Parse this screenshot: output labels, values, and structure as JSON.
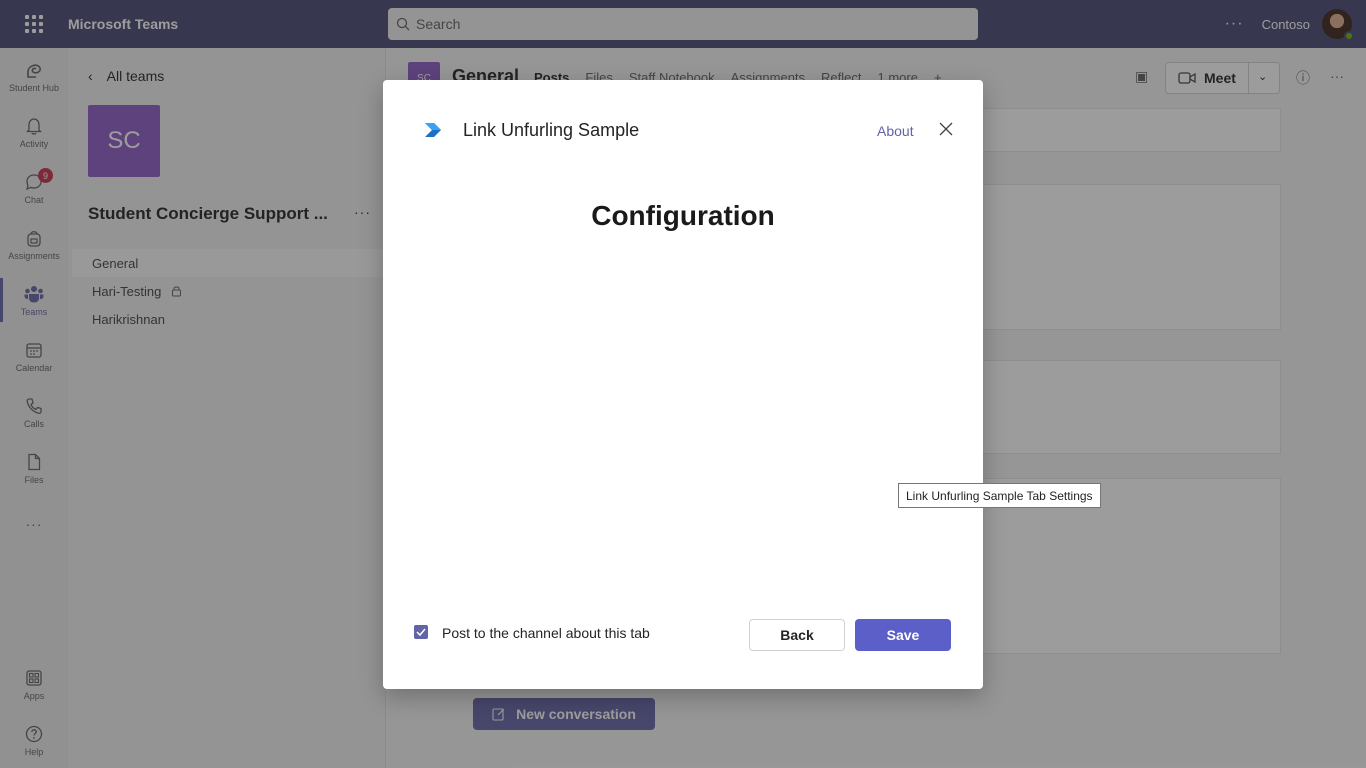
{
  "app": {
    "title": "Microsoft Teams",
    "org": "Contoso"
  },
  "search": {
    "placeholder": "Search"
  },
  "rail": {
    "items": [
      {
        "label": "Student Hub"
      },
      {
        "label": "Activity"
      },
      {
        "label": "Chat",
        "badge": "9"
      },
      {
        "label": "Assignments"
      },
      {
        "label": "Teams"
      },
      {
        "label": "Calendar"
      },
      {
        "label": "Calls"
      },
      {
        "label": "Files"
      },
      {
        "label": "Apps"
      },
      {
        "label": "Help"
      }
    ],
    "more": "···",
    "active": "Teams"
  },
  "team_panel": {
    "back_label": "All teams",
    "avatar_initials": "SC",
    "team_name": "Student Concierge Support ...",
    "more": "···",
    "channels": [
      {
        "name": "General",
        "selected": true
      },
      {
        "name": "Hari-Testing",
        "locked": true
      },
      {
        "name": "Harikrishnan"
      }
    ]
  },
  "channel": {
    "avatar_initials": "SC",
    "title": "General",
    "tabs": [
      "Posts",
      "Files",
      "Staff Notebook",
      "Assignments",
      "Reflect",
      "1 more"
    ],
    "meet_label": "Meet",
    "new_conversation_label": "New conversation"
  },
  "dialog": {
    "app_name": "Link Unfurling Sample",
    "about_label": "About",
    "heading": "Configuration",
    "checkbox_label": "Post to the channel about this tab",
    "checkbox_checked": true,
    "back_label": "Back",
    "save_label": "Save"
  },
  "tooltip": {
    "text": "Link Unfurling Sample Tab Settings"
  },
  "colors": {
    "brand": "#464775",
    "accent": "#6264a7",
    "save": "#5b5fc7",
    "badge": "#c4314b"
  }
}
